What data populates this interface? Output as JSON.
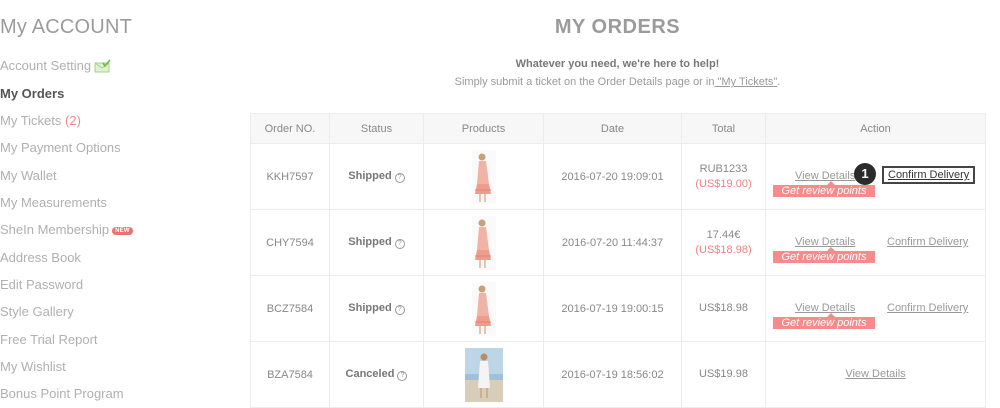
{
  "sidebar": {
    "title": "My ACCOUNT",
    "items": [
      {
        "label": "Account Setting"
      },
      {
        "label": "My Orders"
      },
      {
        "label": "My Tickets",
        "count": "(2)"
      },
      {
        "label": "My Payment Options"
      },
      {
        "label": "My Wallet"
      },
      {
        "label": "My Measurements"
      },
      {
        "label": "SheIn Membership",
        "badge": "NEW"
      },
      {
        "label": "Address Book"
      },
      {
        "label": "Edit Password"
      },
      {
        "label": "Style Gallery"
      },
      {
        "label": "Free Trial Report"
      },
      {
        "label": "My Wishlist"
      },
      {
        "label": "Bonus Point Program"
      }
    ]
  },
  "main": {
    "title": "MY ORDERS",
    "help_line1": "Whatever you need, we're here to help!",
    "help_line2_prefix": "Simply submit a ticket on the Order Details page or in",
    "help_line2_link": " \"My Tickets\"",
    "help_line2_suffix": "."
  },
  "table": {
    "headers": [
      "Order NO.",
      "Status",
      "Products",
      "Date",
      "Total",
      "Action"
    ],
    "rows": [
      {
        "order_no": "KKH7597",
        "status": "Shipped",
        "date": "2016-07-20 19:09:01",
        "total": "RUB1233",
        "total_alt": "(US$19.00)",
        "view": "View Details",
        "confirm": "Confirm Delivery",
        "review": "Get review points",
        "marker": "1"
      },
      {
        "order_no": "CHY7594",
        "status": "Shipped",
        "date": "2016-07-20 11:44:37",
        "total": "17.44€",
        "total_alt": "(US$18.98)",
        "view": "View Details",
        "confirm": "Confirm Delivery",
        "review": "Get review points"
      },
      {
        "order_no": "BCZ7584",
        "status": "Shipped",
        "date": "2016-07-19 19:00:15",
        "total": "US$18.98",
        "view": "View Details",
        "confirm": "Confirm Delivery",
        "review": "Get review points"
      },
      {
        "order_no": "BZA7584",
        "status": "Canceled",
        "date": "2016-07-19 18:56:02",
        "total": "US$19.98",
        "view": "View Details"
      }
    ]
  },
  "icons": {
    "help": "question-circle-icon",
    "setting": "envelope-check-icon"
  },
  "colors": {
    "accent": "#f78b8b",
    "price_alt": "#f08080"
  }
}
